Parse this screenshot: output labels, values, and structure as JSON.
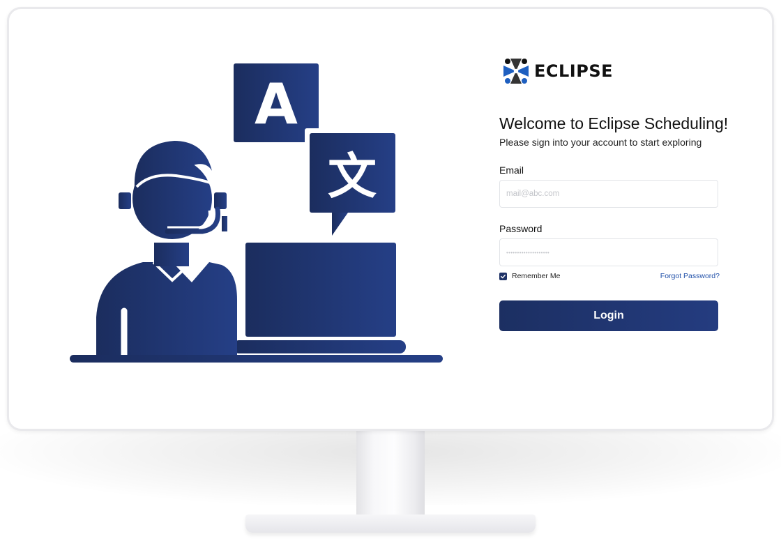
{
  "brand": {
    "name": "ECLIPSE",
    "primary_color": "#1e3266",
    "accent_color": "#1e5fc0"
  },
  "login": {
    "title": "Welcome to Eclipse Scheduling!",
    "subtitle": "Please sign into your account to start exploring",
    "email_label": "Email",
    "email_placeholder": "mail@abc.com",
    "password_label": "Password",
    "password_mask": "••••••••••••••••••••",
    "remember_label": "Remember Me",
    "remember_checked": true,
    "forgot_label": "Forgot Password?",
    "login_button": "Login"
  },
  "illustration": {
    "icons": [
      "support-agent-headset-icon",
      "translate-letter-a-icon",
      "translate-chinese-character-icon",
      "laptop-icon"
    ],
    "glyph_latin": "A",
    "glyph_cjk": "文"
  }
}
